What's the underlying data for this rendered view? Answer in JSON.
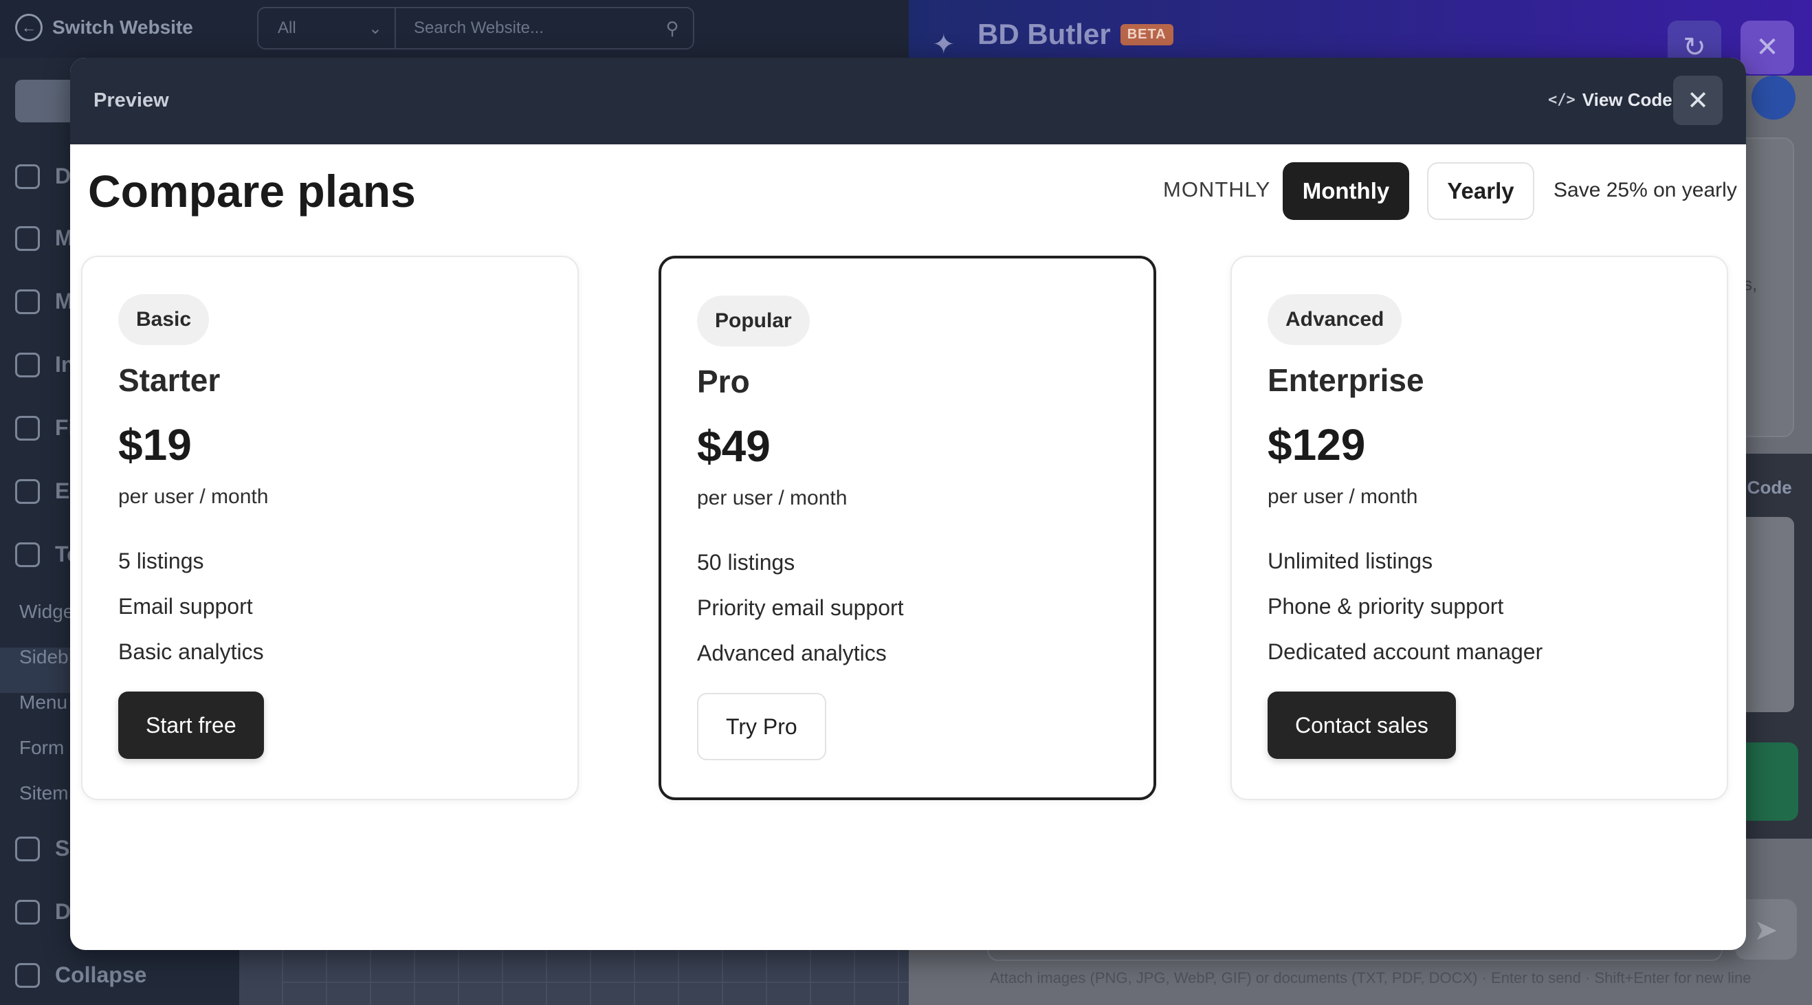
{
  "background": {
    "switch_website": "Switch Website",
    "site_filter": "All",
    "site_search_placeholder": "Search Website...",
    "butler_title": "BD Butler",
    "butler_badge": "BETA",
    "sidebar_letters": [
      "D",
      "M",
      "M",
      "In",
      "Fi",
      "Er",
      "To"
    ],
    "sidebar_subitems": [
      "Widge",
      "Sideb",
      "Menu",
      "Form",
      "Sitem"
    ],
    "sidebar_bottom": [
      "Se",
      "D"
    ],
    "collapse_label": "Collapse",
    "right_code_label": "y Code",
    "right_fragment": "s,",
    "composer_hint": "Attach images (PNG, JPG, WebP, GIF) or documents (TXT, PDF, DOCX) · Enter to send · Shift+Enter for new line"
  },
  "modal": {
    "title": "Preview",
    "view_code_label": "View Code",
    "view_code_icon": "code-icon",
    "close_icon": "close-icon"
  },
  "pricing": {
    "heading": "Compare plans",
    "billing_label": "MONTHLY",
    "toggle": {
      "monthly": "Monthly",
      "yearly": "Yearly",
      "selected": "Monthly"
    },
    "save_note": "Save 25% on yearly",
    "plans": [
      {
        "badge": "Basic",
        "name": "Starter",
        "price": "$19",
        "period": "per user / month",
        "features": [
          "5 listings",
          "Email support",
          "Basic analytics"
        ],
        "cta": "Start free"
      },
      {
        "badge": "Popular",
        "name": "Pro",
        "price": "$49",
        "period": "per user / month",
        "features": [
          "50 listings",
          "Priority email support",
          "Advanced analytics"
        ],
        "cta": "Try Pro"
      },
      {
        "badge": "Advanced",
        "name": "Enterprise",
        "price": "$129",
        "period": "per user / month",
        "features": [
          "Unlimited listings",
          "Phone & priority support",
          "Dedicated account manager"
        ],
        "cta": "Contact sales"
      }
    ]
  }
}
